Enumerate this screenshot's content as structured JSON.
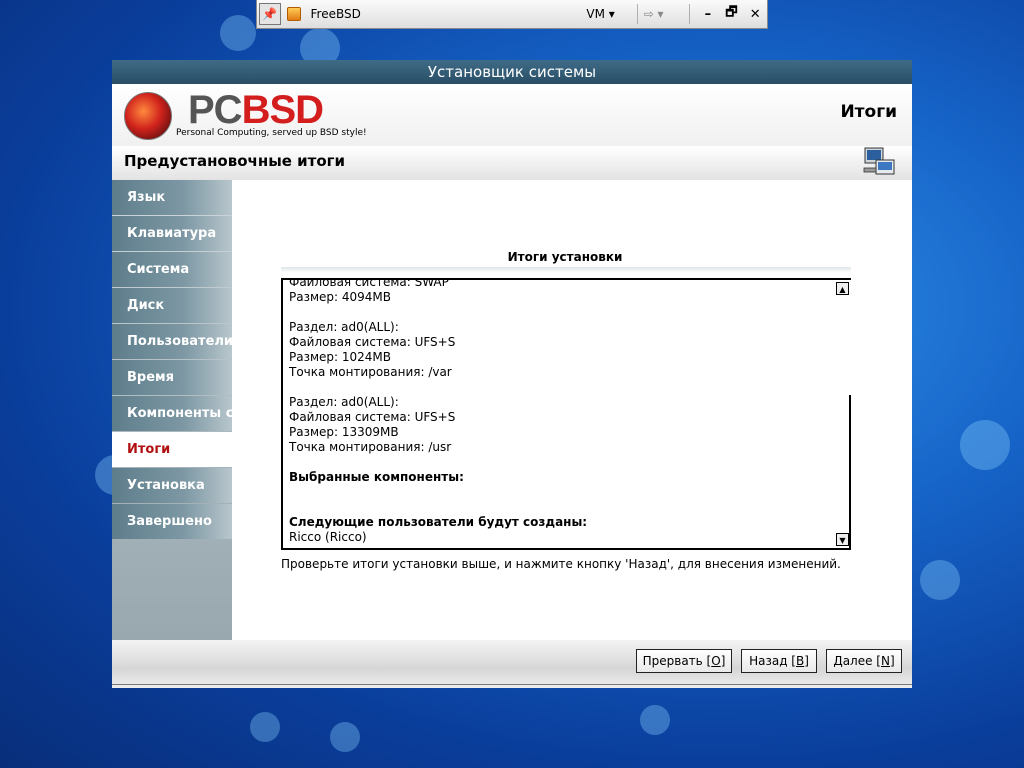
{
  "vm_toolbar": {
    "title": "FreeBSD",
    "menu_label": "VM",
    "pin_icon": "pin-icon",
    "minimize": "–",
    "restore": "🗗",
    "close": "✕"
  },
  "window": {
    "title": "Установщик системы"
  },
  "header": {
    "logo_left": "PC",
    "logo_right": "BSD",
    "logo_tagline": "Personal Computing, served up BSD style!",
    "page_heading": "Итоги"
  },
  "subheader": {
    "title": "Предустановочные итоги"
  },
  "sidebar": {
    "items": [
      {
        "label": "Язык"
      },
      {
        "label": "Клавиатура"
      },
      {
        "label": "Система"
      },
      {
        "label": "Диск"
      },
      {
        "label": "Пользователи"
      },
      {
        "label": "Время"
      },
      {
        "label": "Компоненты системы"
      },
      {
        "label": "Итоги"
      },
      {
        "label": "Установка"
      },
      {
        "label": "Завершено"
      }
    ],
    "active_index": 7
  },
  "summary": {
    "title": "Итоги установки",
    "lines": [
      {
        "text": "Файловая система: SWAP"
      },
      {
        "text": "Размер: 4094MB"
      },
      {
        "text": ""
      },
      {
        "text": "Раздел: ad0(ALL):"
      },
      {
        "text": "Файловая система: UFS+S"
      },
      {
        "text": "Размер: 1024MB"
      },
      {
        "text": "Точка монтирования: /var"
      },
      {
        "text": ""
      },
      {
        "text": "Раздел: ad0(ALL):"
      },
      {
        "text": "Файловая система: UFS+S"
      },
      {
        "text": "Размер: 13309MB"
      },
      {
        "text": "Точка монтирования: /usr"
      },
      {
        "text": ""
      },
      {
        "text": "Выбранные компоненты:",
        "bold": true
      },
      {
        "text": ""
      },
      {
        "text": ""
      },
      {
        "text": "Следующие пользователи будут созданы:",
        "bold": true
      },
      {
        "text": "Ricco (Ricco)"
      }
    ],
    "hint": "Проверьте итоги установки выше, и нажмите кнопку 'Назад', для внесения изменений."
  },
  "buttons": {
    "abort": {
      "label": "Прервать [",
      "mnemonic": "O",
      "end": "]"
    },
    "back": {
      "label": "Назад [",
      "mnemonic": "B",
      "end": "]"
    },
    "next": {
      "label": "Далее [",
      "mnemonic": "N",
      "end": "]"
    }
  }
}
